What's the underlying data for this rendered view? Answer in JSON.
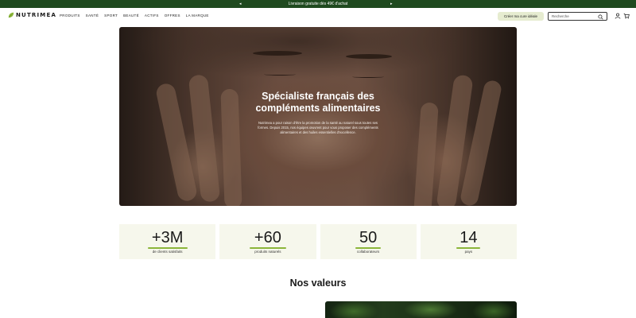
{
  "promo": {
    "text": "Livraison gratuite dès 49€ d'achat",
    "prev_arrow": "◂",
    "next_arrow": "▸"
  },
  "header": {
    "brand": "NUTRIMEA",
    "nav": [
      "PRODUITS",
      "SANTÉ",
      "SPORT",
      "BEAUTÉ",
      "ACTIFS",
      "OFFRES",
      "LA MARQUE"
    ],
    "cta_label": "Créer ma cure idéale",
    "search_placeholder": "Recherche",
    "icons": [
      "leaf-logo-icon",
      "search-icon",
      "user-icon",
      "cart-icon"
    ]
  },
  "hero": {
    "title_line1": "Spécialiste français des",
    "title_line2": "compléments alimentaires",
    "description": "Nutrimea a pour raison d'être la promotion de la santé au naturel sous toutes ses formes. Depuis 2015, nos équipes œuvrent pour vous proposer des compléments alimentaires et des huiles essentielles d'excellence."
  },
  "stats": [
    {
      "value": "+3M",
      "label": "de clients satisfaits"
    },
    {
      "value": "+60",
      "label": "produits naturels"
    },
    {
      "value": "50",
      "label": "collaborateurs"
    },
    {
      "value": "14",
      "label": "pays"
    }
  ],
  "values_section": {
    "title": "Nos valeurs"
  },
  "colors": {
    "promo_bg": "#1f4a1f",
    "cta_bg": "#e6ecd0",
    "stat_bg": "#f6f7ec",
    "accent_green": "#8bb53a"
  }
}
